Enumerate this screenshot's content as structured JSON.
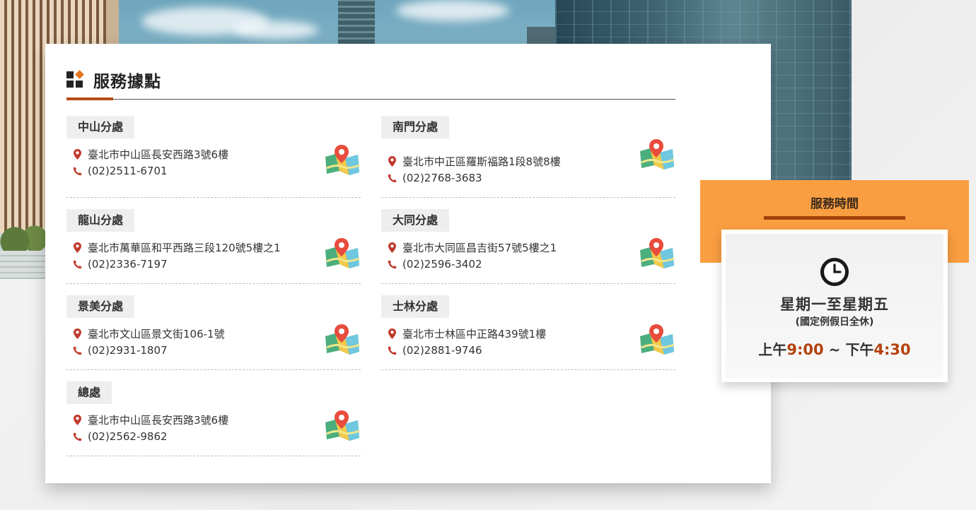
{
  "section": {
    "title": "服務據點"
  },
  "offices": [
    {
      "name": "中山分處",
      "address": "臺北市中山區長安西路3號6樓",
      "phone": "(02)2511-6701"
    },
    {
      "name": "南門分處",
      "address": "臺北市中正區羅斯福路1段8號8樓",
      "phone": "(02)2768-3683"
    },
    {
      "name": "龍山分處",
      "address": "臺北市萬華區和平西路三段120號5樓之1",
      "phone": "(02)2336-7197"
    },
    {
      "name": "大同分處",
      "address": "臺北市大同區昌吉街57號5樓之1",
      "phone": "(02)2596-3402"
    },
    {
      "name": "景美分處",
      "address": "臺北市文山區景文街106-1號",
      "phone": "(02)2931-1807"
    },
    {
      "name": "士林分處",
      "address": "臺北市士林區中正路439號1樓",
      "phone": "(02)2881-9746"
    },
    {
      "name": "總處",
      "address": "臺北市中山區長安西路3號6樓",
      "phone": "(02)2562-9862"
    }
  ],
  "hours": {
    "title": "服務時間",
    "days": "星期一至星期五",
    "note": "(國定例假日全休)",
    "am_label": "上午",
    "open_time": "9:00",
    "separator": " ~ ",
    "pm_label": "下午",
    "close_time": "4:30"
  },
  "icons": {
    "address": "map-marker-icon",
    "phone": "phone-icon",
    "map": "map-pin-icon",
    "clock": "clock-icon"
  },
  "colors": {
    "accent_orange": "#fa9e42",
    "accent_dark_orange": "#b44c14",
    "icon_red": "#c0392b"
  }
}
